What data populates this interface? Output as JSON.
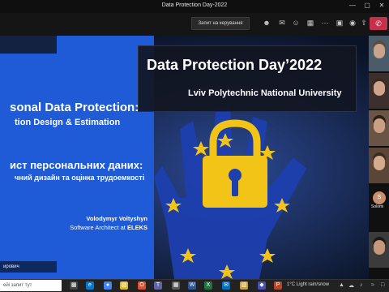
{
  "window": {
    "title": "Data Protection Day-2022",
    "minimize_glyph": "—",
    "maximize_glyph": "▢",
    "close_glyph": "✕"
  },
  "toolbar": {
    "request_control_label": "Запит на керування",
    "icons": [
      "people-icon",
      "chat-icon",
      "reaction-icon",
      "rooms-icon",
      "more-icon",
      "camera-icon",
      "mic-icon",
      "share-icon"
    ],
    "leave_glyph": "✆",
    "leave_color": "#c4314b"
  },
  "slide": {
    "accent_color": "#1f5bd6",
    "en_title": "sonal Data Protection:",
    "en_subtitle": "tion Design & Estimation",
    "ua_title": "ист персональних даних:",
    "ua_subtitle": "чний дизайн та оцінка трудоемкості",
    "author_name": "Volodymyr Voltyshyn",
    "author_role_prefix": "Software Architect at",
    "author_company": "ELEKS",
    "event_title": "Data Protection Day’2022",
    "event_subtitle": "Lviv Polytechnic National University",
    "presenter_tag": "ирович"
  },
  "participants": {
    "avatar_initials": "S",
    "avatar_name": "Solomi"
  },
  "taskbar": {
    "search_placeholder": "ейі запит тут",
    "weather": "1°C  Light rain/snow",
    "app_icons": [
      "start-icon",
      "task-view-icon",
      "explorer-icon",
      "chrome-icon",
      "edge-icon",
      "teams-icon",
      "store-icon",
      "word-icon",
      "excel-icon",
      "mail-icon",
      "folder-icon"
    ]
  }
}
